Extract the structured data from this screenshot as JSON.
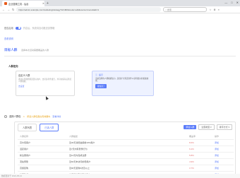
{
  "browser": {
    "tab_title": "企业营销工具 - 后台",
    "url": "https://admin.example.com/marketing/strategy?id=482&mode=edit&source=menu&tab=1",
    "search_placeholder": "搜索",
    "window_buttons": [
      "—",
      "□",
      "✕"
    ]
  },
  "settings": {
    "toggle_label": "是否启用",
    "hint": "开启后，系统将自动推送该策略",
    "link": "查看说明"
  },
  "section": {
    "title": "目标人群",
    "subtitle": "选择本次活动需要覆盖的人群"
  },
  "subhead": "人群定向",
  "card": {
    "title": "自定义人群",
    "desc": "通过标签规则筛选目标用户，支持多条件组合，并可在保存后预览人群规模。",
    "link": "去设置"
  },
  "tip": {
    "title": "提示",
    "desc": "当前选择的人群规模较小，建议扩大筛选条件以获得更好的投放效果。",
    "button": "我知道了"
  },
  "control": {
    "label": "选择人群包",
    "warning": "所选人群包需在有效期内",
    "link": "查看详情"
  },
  "panel": {
    "tabs": [
      "人群列表",
      "已选人群"
    ],
    "add_button": "添加人群",
    "select1": "全部类型",
    "select2": "排序方式"
  },
  "table": {
    "headers": [
      "人群名称",
      "人群描述",
      "",
      "覆盖率",
      "操作"
    ],
    "rows": [
      [
        "高价值客户",
        "近30天消费金额前10%用户",
        "",
        "8.6%",
        "添加"
      ],
      [
        "活跃用户",
        "近7天内有登录行为",
        "",
        "6.2%",
        "添加"
      ],
      [
        "新注册用户",
        "近14天内完成注册",
        "",
        "5.8%",
        "添加"
      ],
      [
        "流失预警",
        "近60天未访问的老用户",
        "",
        "4.9%",
        "添加"
      ],
      [
        "高频复购",
        "近90天复购3次及以上",
        "",
        "3.7%",
        "添加"
      ],
      [
        "优惠敏感",
        "常使用优惠券下单用户",
        "",
        "2.5%",
        "添加"
      ],
      [
        "会员用户",
        "当前为付费会员状态",
        "",
        "1.8%",
        "添加"
      ]
    ]
  },
  "status": "数据更新于 2024-05-12"
}
